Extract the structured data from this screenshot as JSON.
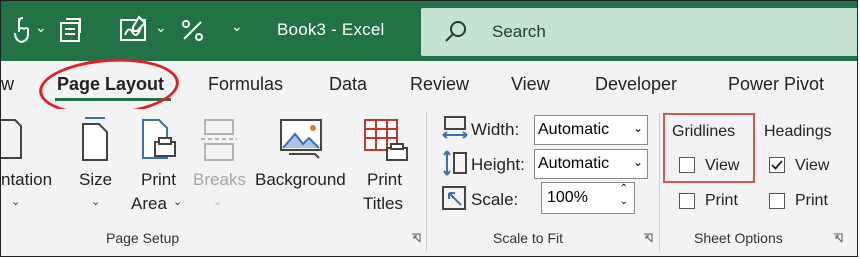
{
  "window": {
    "title": "Book3  -  Excel",
    "search_label": "Search"
  },
  "qat": {
    "icons": [
      "touch-mode-icon",
      "chevron-down-icon",
      "form-icon",
      "signature-icon",
      "percent-style-icon",
      "customize-qat-icon"
    ]
  },
  "tabs": [
    "w",
    "Page Layout",
    "Formulas",
    "Data",
    "Review",
    "View",
    "Developer",
    "Power Pivot"
  ],
  "page_setup": {
    "orientation_label": "ntation",
    "size_label": "Size",
    "print_area_line1": "Print",
    "print_area_line2": "Area",
    "breaks_label": "Breaks",
    "background_label": "Background",
    "print_titles_line1": "Print",
    "print_titles_line2": "Titles",
    "group_label": "Page Setup"
  },
  "scale_to_fit": {
    "width_label": "Width:",
    "width_value": "Automatic",
    "height_label": "Height:",
    "height_value": "Automatic",
    "scale_label": "Scale:",
    "scale_value": "100%",
    "group_label": "Scale to Fit"
  },
  "sheet_options": {
    "gridlines_header": "Gridlines",
    "headings_header": "Headings",
    "view_label": "View",
    "print_label": "Print",
    "gridlines_view_checked": false,
    "gridlines_print_checked": false,
    "headings_view_checked": true,
    "headings_print_checked": false,
    "group_label": "Sheet Options"
  },
  "colors": {
    "excel_green": "#217346",
    "annotation_red": "#e21f26"
  }
}
